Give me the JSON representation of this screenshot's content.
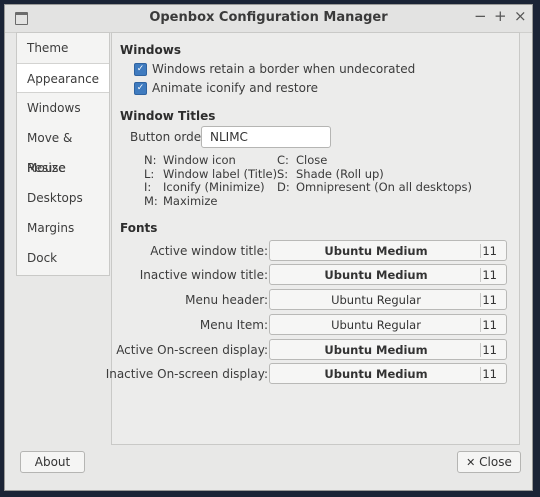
{
  "window": {
    "title": "Openbox Configuration Manager"
  },
  "titlebar_buttons": {
    "minimize": "−",
    "maximize": "+",
    "close": "×"
  },
  "sidebar": {
    "items": [
      {
        "label": "Theme"
      },
      {
        "label": "Appearance",
        "selected": true
      },
      {
        "label": "Windows"
      },
      {
        "label": "Move & Resize"
      },
      {
        "label": "Mouse"
      },
      {
        "label": "Desktops"
      },
      {
        "label": "Margins"
      },
      {
        "label": "Dock"
      }
    ]
  },
  "windows_section": {
    "title": "Windows",
    "options": [
      {
        "label": "Windows retain a border when undecorated",
        "checked": true
      },
      {
        "label": "Animate iconify and restore",
        "checked": true
      }
    ]
  },
  "window_titles": {
    "title": "Window Titles",
    "button_order_label": "Button order:",
    "button_order_value": "NLIMC",
    "legend_left": [
      {
        "key": "N:",
        "desc": "Window icon"
      },
      {
        "key": "L:",
        "desc": "Window label (Title)"
      },
      {
        "key": "I:",
        "desc": "Iconify (Minimize)"
      },
      {
        "key": "M:",
        "desc": "Maximize"
      }
    ],
    "legend_right": [
      {
        "key": "C:",
        "desc": "Close"
      },
      {
        "key": "S:",
        "desc": "Shade (Roll up)"
      },
      {
        "key": "D:",
        "desc": "Omnipresent (On all desktops)"
      }
    ]
  },
  "fonts": {
    "title": "Fonts",
    "rows": [
      {
        "label": "Active window title:",
        "font": "Ubuntu Medium",
        "size": "11",
        "bold": true
      },
      {
        "label": "Inactive window title:",
        "font": "Ubuntu Medium",
        "size": "11",
        "bold": true
      },
      {
        "label": "Menu header:",
        "font": "Ubuntu Regular",
        "size": "11",
        "bold": false
      },
      {
        "label": "Menu Item:",
        "font": "Ubuntu Regular",
        "size": "11",
        "bold": false
      },
      {
        "label": "Active On-screen display:",
        "font": "Ubuntu Medium",
        "size": "11",
        "bold": true
      },
      {
        "label": "Inactive On-screen display:",
        "font": "Ubuntu Medium",
        "size": "11",
        "bold": true
      }
    ]
  },
  "bottom": {
    "about_label": "About",
    "close_label": "Close",
    "close_icon": "✕"
  },
  "colors": {
    "checkbox": "#3f7bbf",
    "desktop": "#1b2436"
  }
}
